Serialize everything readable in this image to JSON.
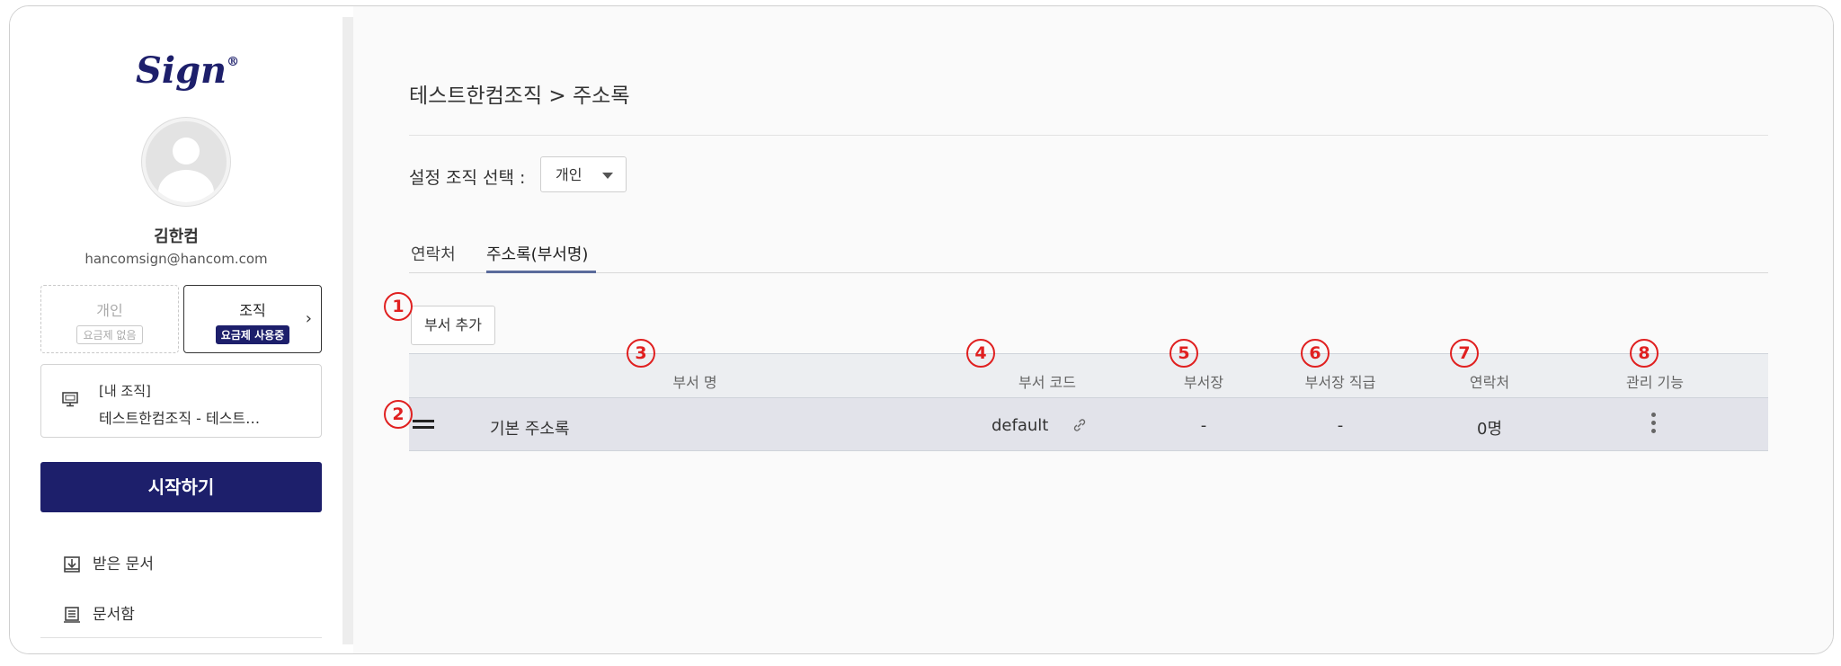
{
  "sidebar": {
    "logo": "Sign",
    "logo_mark": "®",
    "user_name": "김한컴",
    "user_email": "hancomsign@hancom.com",
    "plans": {
      "personal": {
        "title": "개인",
        "badge": "요금제 없음"
      },
      "organization": {
        "title": "조직",
        "badge": "요금제 사용중"
      }
    },
    "my_org": {
      "label": "[내 조직]",
      "name": "테스트한컴조직 - 테스트…"
    },
    "start_button": "시작하기",
    "nav": [
      {
        "label": "받은 문서",
        "icon": "inbox-download-icon"
      },
      {
        "label": "문서함",
        "icon": "document-box-icon"
      }
    ]
  },
  "main": {
    "breadcrumb": "테스트한컴조직 > 주소록",
    "org_select": {
      "label": "설정 조직 선택 :",
      "value": "개인"
    },
    "tabs": [
      {
        "label": "연락처",
        "active": false
      },
      {
        "label": "주소록(부서명)",
        "active": true
      }
    ],
    "add_dept_button": "부서 추가",
    "table": {
      "columns": [
        "부서 명",
        "부서 코드",
        "부서장",
        "부서장 직급",
        "연락처",
        "관리 기능"
      ],
      "rows": [
        {
          "name": "기본 주소록",
          "code": "default",
          "head": "-",
          "head_rank": "-",
          "contacts": "0명"
        }
      ]
    },
    "markers": [
      "1",
      "2",
      "3",
      "4",
      "5",
      "6",
      "7",
      "8"
    ]
  },
  "colors": {
    "brand": "#1d1f6b",
    "marker": "#e02020",
    "row_bg": "#e2e3ea",
    "header_bg": "#eceef1"
  }
}
